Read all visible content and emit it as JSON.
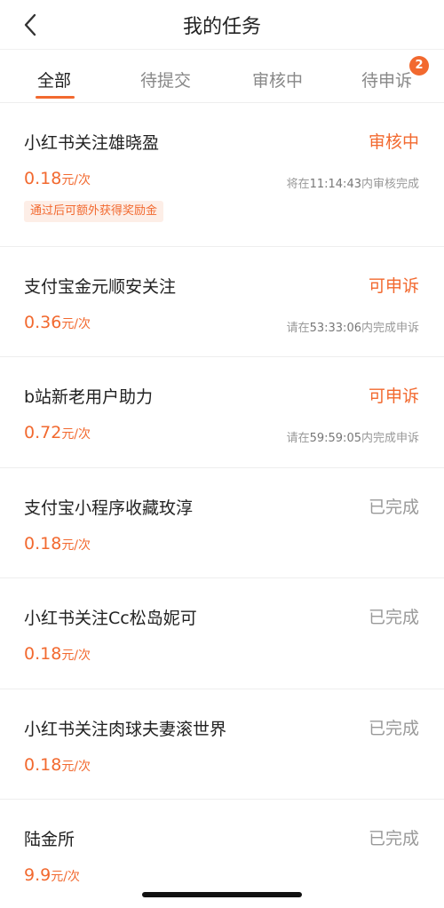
{
  "header": {
    "title": "我的任务"
  },
  "tabs": [
    {
      "label": "全部"
    },
    {
      "label": "待提交"
    },
    {
      "label": "审核中"
    },
    {
      "label": "待申诉",
      "badge": "2"
    }
  ],
  "tasks": [
    {
      "name": "小红书关注雄晓盈",
      "status": "审核中",
      "price": "0.18",
      "unit": "元/次",
      "note_prefix": "将在",
      "note_time": "11:14:43",
      "note_suffix": "内审核完成",
      "tag": "通过后可额外获得奖励金"
    },
    {
      "name": "支付宝金元顺安关注",
      "status": "可申诉",
      "price": "0.36",
      "unit": "元/次",
      "note_prefix": "请在",
      "note_time": "53:33:06",
      "note_suffix": "内完成申诉"
    },
    {
      "name": "b站新老用户助力",
      "status": "可申诉",
      "price": "0.72",
      "unit": "元/次",
      "note_prefix": "请在",
      "note_time": "59:59:05",
      "note_suffix": "内完成申诉"
    },
    {
      "name": "支付宝小程序收藏玫淳",
      "status": "已完成",
      "price": "0.18",
      "unit": "元/次"
    },
    {
      "name": "小红书关注Cc松岛妮可",
      "status": "已完成",
      "price": "0.18",
      "unit": "元/次"
    },
    {
      "name": "小红书关注肉球夫妻滚世界",
      "status": "已完成",
      "price": "0.18",
      "unit": "元/次"
    },
    {
      "name": "陆金所",
      "status": "已完成",
      "price": "9.9",
      "unit": "元/次"
    }
  ],
  "colors": {
    "accent": "#f2692f",
    "muted": "#999999"
  }
}
